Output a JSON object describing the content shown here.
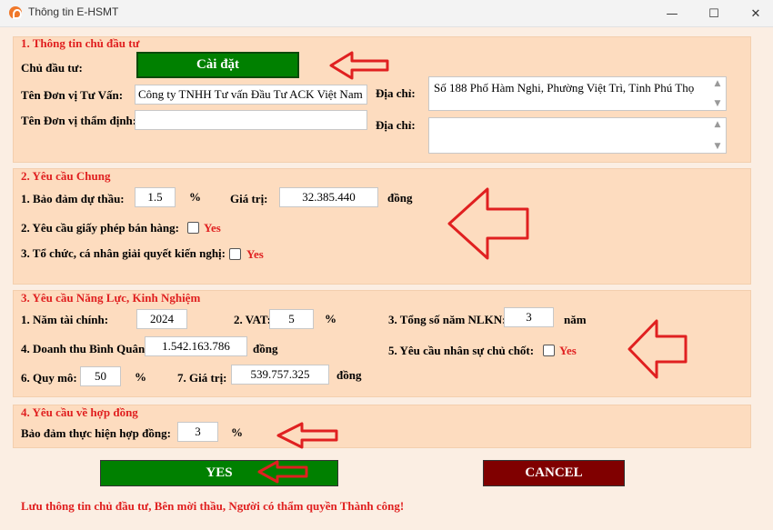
{
  "window": {
    "title": "Thông tin E-HSMT",
    "minimize": "—",
    "maximize": "☐",
    "close": "✕"
  },
  "section1": {
    "title": "1. Thông tin chủ đầu tư",
    "owner_label": "Chủ đầu tư:",
    "setup_button": "Cài đặt",
    "consultant_label": "Tên Đơn vị Tư Vấn:",
    "consultant_value": "Công ty TNHH Tư vấn Đầu Tư ACK Việt Nam",
    "appraiser_label": "Tên Đơn vị thẩm định:",
    "appraiser_value": "",
    "address_label_1": "Địa chỉ:",
    "address_value_1": "Số 188 Phố Hàm Nghi, Phường Việt Trì, Tỉnh Phú Thọ",
    "address_label_2": "Địa chỉ:",
    "address_value_2": ""
  },
  "section2": {
    "title": "2. Yêu cầu Chung",
    "bid_security_label": "1. Bảo đảm dự thầu:",
    "bid_security_value": "1.5",
    "percent": "%",
    "value_label": "Giá trị:",
    "value_amount": "32.385.440",
    "currency": "đồng",
    "sales_license_label": "2. Yêu cầu giấy phép bán hàng:",
    "sales_license_yes": "Yes",
    "complaint_label": "3. Tổ chức, cá nhân giải quyết kiến nghị:",
    "complaint_yes": "Yes"
  },
  "section3": {
    "title": "3. Yêu cầu Năng Lực, Kinh Nghiệm",
    "fiscal_year_label": "1. Năm tài chính:",
    "fiscal_year_value": "2024",
    "vat_label": "2. VAT:",
    "vat_value": "5",
    "vat_unit": "%",
    "experience_label": "3. Tổng số năm NLKN:",
    "experience_value": "3",
    "experience_unit": "năm",
    "revenue_label": "4. Doanh thu Bình Quân:",
    "revenue_value": "1.542.163.786",
    "revenue_unit": "đồng",
    "key_personnel_label": "5. Yêu cầu nhân sự chủ chốt:",
    "key_personnel_yes": "Yes",
    "scale_label": "6. Quy mô:",
    "scale_value": "50",
    "scale_unit": "%",
    "value7_label": "7. Giá trị:",
    "value7_amount": "539.757.325",
    "value7_unit": "đồng"
  },
  "section4": {
    "title": "4. Yêu cầu về hợp đồng",
    "performance_label": "Bảo đảm thực hiện hợp đồng:",
    "performance_value": "3",
    "performance_unit": "%"
  },
  "actions": {
    "yes": "YES",
    "cancel": "CANCEL"
  },
  "status_message": "Lưu thông tin chủ đầu tư, Bên mời thầu, Người có thẩm quyền Thành công!",
  "colors": {
    "panel": "#fddcbf",
    "accent_red": "#e02020",
    "btn_green": "#008000",
    "btn_maroon": "#800000"
  }
}
